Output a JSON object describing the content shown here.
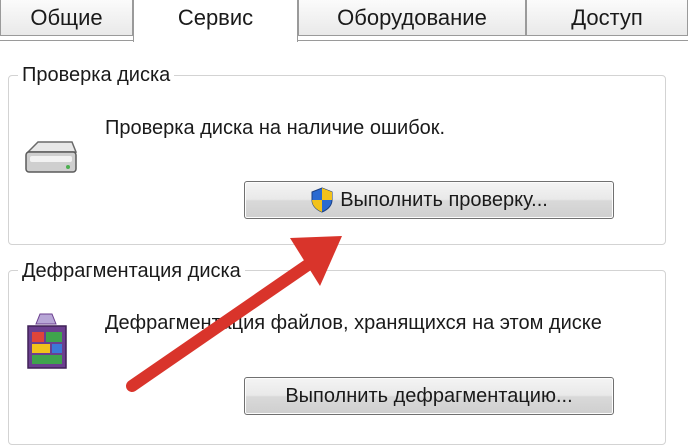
{
  "tabs": [
    {
      "label": "Общие"
    },
    {
      "label": "Сервис"
    },
    {
      "label": "Оборудование"
    },
    {
      "label": "Доступ"
    }
  ],
  "check_disk": {
    "legend": "Проверка диска",
    "description": "Проверка диска на наличие ошибок.",
    "button_label": "Выполнить проверку..."
  },
  "defrag": {
    "legend": "Дефрагментация диска",
    "description": "Дефрагментация файлов, хранящихся на этом диске",
    "button_label": "Выполнить дефрагментацию..."
  },
  "icons": [
    "drive-icon",
    "defrag-icon",
    "uac-shield-icon",
    "red-arrow"
  ],
  "colors": {
    "arrow": "#d9342b",
    "shield_blue": "#2a6ad1",
    "shield_yellow": "#f2c21b"
  }
}
